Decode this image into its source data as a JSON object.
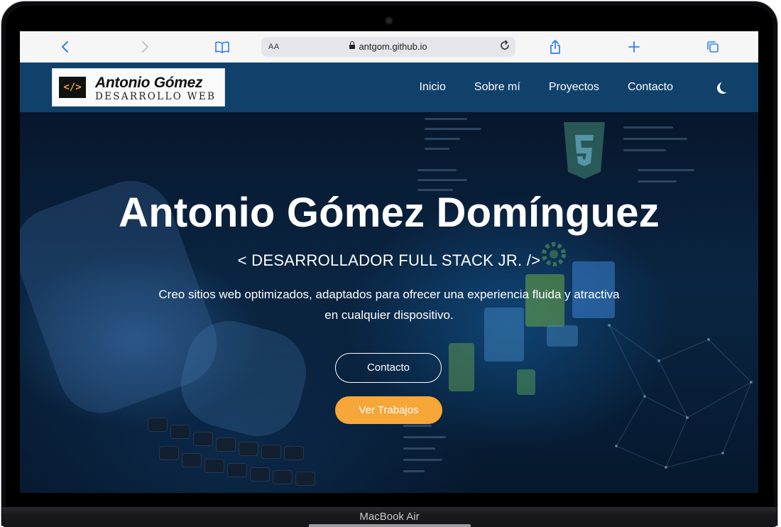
{
  "device": {
    "label": "MacBook Air"
  },
  "browser": {
    "text_size_label": "AA",
    "url": "antgom.github.io",
    "icons": [
      "back-icon",
      "forward-icon",
      "bookmarks-icon",
      "reload-icon",
      "share-icon",
      "new-tab-icon",
      "tabs-icon"
    ]
  },
  "nav": {
    "logo_mark": "</>",
    "logo_name": "Antonio Gómez",
    "logo_sub": "DESARROLLO WEB",
    "links": [
      "Inicio",
      "Sobre mí",
      "Proyectos",
      "Contacto"
    ],
    "theme_icon": "moon-icon"
  },
  "hero": {
    "title": "Antonio Gómez Domínguez",
    "subtitle": "< DESARROLLADOR FULL STACK JR. />",
    "description": "Creo sitios web optimizados, adaptados para ofrecer una experiencia fluida y atractiva en cualquier dispositivo.",
    "button_primary": "Contacto",
    "button_secondary": "Ver Trabajos"
  },
  "colors": {
    "nav_bg": "#10416b",
    "accent_orange": "#f7a638",
    "browser_blue": "#2f7df6"
  }
}
